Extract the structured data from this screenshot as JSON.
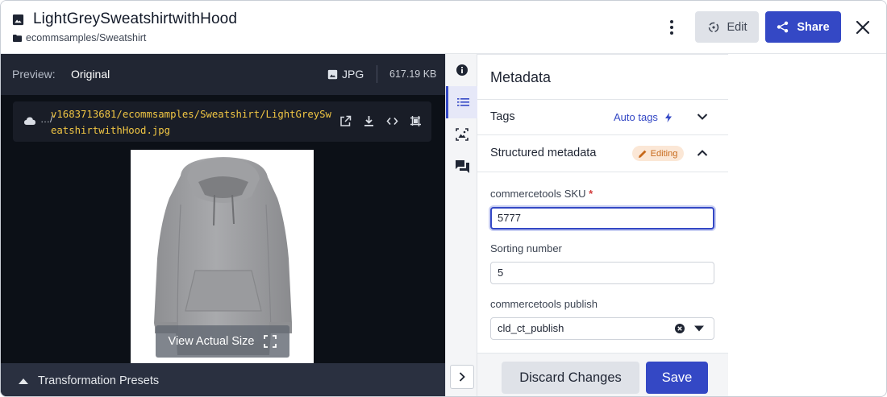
{
  "header": {
    "title": "LightGreySweatshirtwithHood",
    "folder_path": "ecommsamples/Sweatshirt",
    "edit_label": "Edit",
    "share_label": "Share"
  },
  "preview": {
    "label": "Preview:",
    "value": "Original",
    "format": "JPG",
    "file_size": "617.19 KB",
    "url_prefix": "…/",
    "url": "v1683713681/ecommsamples/Sweatshirt/LightGreySweatshirtwithHood.jpg",
    "view_actual_size_label": "View Actual Size",
    "transformation_presets_label": "Transformation Presets"
  },
  "metadata": {
    "title": "Metadata",
    "tags_label": "Tags",
    "auto_tags_label": "Auto tags",
    "structured_label": "Structured metadata",
    "editing_badge": "Editing",
    "fields": [
      {
        "label": "commercetools SKU",
        "required": "*",
        "value": "5777"
      },
      {
        "label": "Sorting number",
        "value": "5"
      },
      {
        "label": "commercetools publish",
        "value": "cld_ct_publish"
      }
    ]
  },
  "footer": {
    "discard_label": "Discard Changes",
    "save_label": "Save"
  },
  "colors": {
    "primary": "#3448c5",
    "url_text": "#f2c744",
    "editing_badge_bg": "#fbe7d6",
    "editing_badge_fg": "#c76a1c",
    "preview_bg": "#0c1017"
  },
  "icons": [
    "image-icon",
    "folder-icon",
    "more-vertical-icon",
    "edit-transform-icon",
    "share-icon",
    "close-icon",
    "cloud-icon",
    "external-link-icon",
    "download-icon",
    "code-icon",
    "crop-icon",
    "fullscreen-icon",
    "caret-up-icon",
    "info-icon",
    "list-icon",
    "image-analysis-icon",
    "comments-icon",
    "chevron-right-icon",
    "bolt-icon",
    "chevron-down-icon",
    "chevron-up-icon",
    "pencil-icon",
    "clear-icon"
  ]
}
